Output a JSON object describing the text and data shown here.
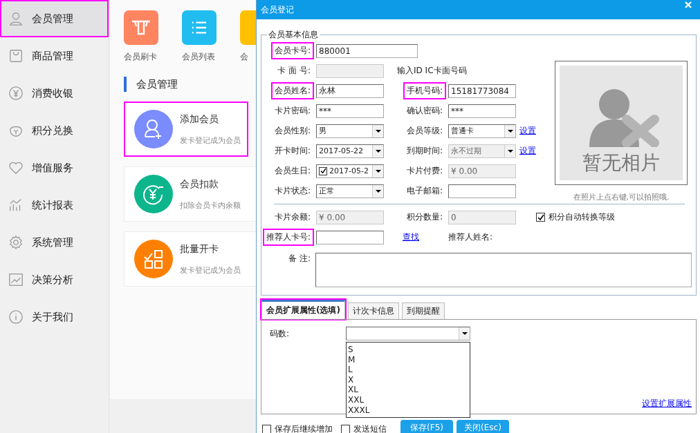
{
  "sidebar": {
    "items": [
      {
        "label": "会员管理",
        "selected": true,
        "highlighted": true
      },
      {
        "label": "商品管理",
        "selected": false,
        "highlighted": false
      },
      {
        "label": "消费收银",
        "selected": false,
        "highlighted": false
      },
      {
        "label": "积分兑换",
        "selected": false,
        "highlighted": false
      },
      {
        "label": "增值服务",
        "selected": false,
        "highlighted": false
      },
      {
        "label": "统计报表",
        "selected": false,
        "highlighted": false
      },
      {
        "label": "系统管理",
        "selected": false,
        "highlighted": false
      },
      {
        "label": "决策分析",
        "selected": false,
        "highlighted": false
      },
      {
        "label": "关于我们",
        "selected": false,
        "highlighted": false
      }
    ]
  },
  "quick_actions": [
    {
      "label": "会员刷卡",
      "color": "#ff8561"
    },
    {
      "label": "会员列表",
      "color": "#21bdf0"
    },
    {
      "label": "会",
      "color": "#ffc000"
    }
  ],
  "section_title": "会员管理",
  "cards": [
    {
      "title": "添加会员",
      "subtitle": "发卡登记成为会员",
      "color": "#7b8cff",
      "highlighted": true
    },
    {
      "title": "会员扣款",
      "subtitle": "扣除会员卡内余额",
      "color": "#0db58d",
      "highlighted": false
    },
    {
      "title": "批量开卡",
      "subtitle": "发卡登记成为会员",
      "color": "#ff8000",
      "highlighted": false
    }
  ],
  "dialog": {
    "title": "会员登记",
    "basic_info": {
      "legend": "会员基本信息",
      "rows": [
        [
          {
            "kind": "label",
            "text": "会员卡号:",
            "highlighted": true
          },
          {
            "kind": "input_wide",
            "value": "880001",
            "disabled": false
          }
        ],
        [
          {
            "kind": "label",
            "text": "卡 面 号:",
            "highlighted": false
          },
          {
            "kind": "input",
            "disabled": true
          },
          {
            "kind": "note",
            "text": "输入ID IC卡面号码"
          }
        ],
        [
          {
            "kind": "label",
            "text": "会员姓名:",
            "highlighted": true
          },
          {
            "kind": "input",
            "value": "永林",
            "disabled": false
          },
          {
            "kind": "label",
            "text": "手机号码:",
            "highlighted": true
          },
          {
            "kind": "input",
            "value": "15181773084",
            "disabled": false
          }
        ],
        [
          {
            "kind": "label",
            "text": "卡片密码:",
            "highlighted": false
          },
          {
            "kind": "input",
            "value": "***",
            "disabled": false
          },
          {
            "kind": "label",
            "text": "确认密码:",
            "highlighted": false
          },
          {
            "kind": "input",
            "value": "***",
            "disabled": false
          }
        ],
        [
          {
            "kind": "label",
            "text": "会员性别:",
            "highlighted": false
          },
          {
            "kind": "combo",
            "value": "男",
            "disabled": false
          },
          {
            "kind": "label",
            "text": "会员等级:",
            "highlighted": false
          },
          {
            "kind": "combo",
            "value": "普通卡",
            "disabled": false
          },
          {
            "kind": "link",
            "text": "设置"
          }
        ],
        [
          {
            "kind": "label",
            "text": "开卡时间:",
            "highlighted": false
          },
          {
            "kind": "combo",
            "value": "2017-05-22",
            "disabled": false
          },
          {
            "kind": "label",
            "text": "到期时间:",
            "highlighted": false
          },
          {
            "kind": "combo",
            "value": "永不过期",
            "disabled": true
          },
          {
            "kind": "link",
            "text": "设置"
          }
        ],
        [
          {
            "kind": "label",
            "text": "会员生日:",
            "highlighted": false
          },
          {
            "kind": "date",
            "value": "2017-05-2",
            "checked": true
          },
          {
            "kind": "label",
            "text": "卡片付费:",
            "highlighted": false
          },
          {
            "kind": "input",
            "value": "¥ 0.00",
            "disabled": true
          }
        ],
        [
          {
            "kind": "label",
            "text": "卡片状态:",
            "highlighted": false
          },
          {
            "kind": "combo",
            "value": "正常",
            "disabled": false
          },
          {
            "kind": "label",
            "text": "电子邮箱:",
            "highlighted": false
          },
          {
            "kind": "input",
            "disabled": false
          }
        ]
      ],
      "rows_after": [
        [
          {
            "kind": "label",
            "text": "卡片余额:",
            "highlighted": false
          },
          {
            "kind": "input",
            "value": "¥ 0.00",
            "disabled": true
          },
          {
            "kind": "label",
            "text": "积分数量:",
            "highlighted": false
          },
          {
            "kind": "input",
            "value": "0",
            "disabled": true
          },
          {
            "kind": "check",
            "text": "积分自动转换等级",
            "checked": true
          }
        ],
        [
          {
            "kind": "label",
            "text": "推荐人卡号:",
            "highlighted": true
          },
          {
            "kind": "input",
            "disabled": false
          },
          {
            "kind": "link",
            "text": "查找"
          },
          {
            "kind": "text",
            "text": "推荐人姓名:"
          }
        ]
      ],
      "remark_label": "备 注:",
      "photo": {
        "text": "暂无相片",
        "hint": "在照片上点右键,可以拍照哦."
      }
    },
    "tabs": [
      {
        "label": "会员扩展属性(选填)",
        "selected": true,
        "highlighted": true
      },
      {
        "label": "计次卡信息",
        "selected": false,
        "highlighted": false
      },
      {
        "label": "到期提醒",
        "selected": false,
        "highlighted": false
      }
    ],
    "size_field": {
      "label": "码数:",
      "options": [
        "S",
        "M",
        "L",
        "X",
        "XL",
        "XXL",
        "XXXL"
      ]
    },
    "settings_link": "设置扩展属性",
    "footer_checks": [
      {
        "label": "保存后继续增加",
        "checked": false
      },
      {
        "label": "发送短信",
        "checked": false
      }
    ],
    "buttons": [
      "保存(F5)",
      "关闭(Esc)"
    ]
  }
}
